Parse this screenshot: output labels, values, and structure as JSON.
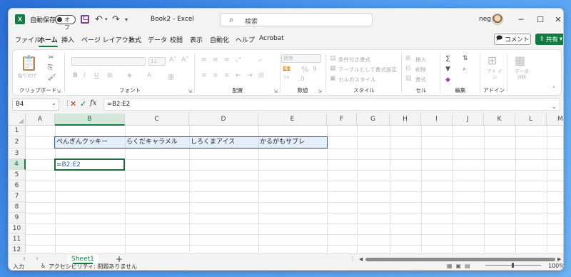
{
  "titlebar": {
    "autosave_label": "自動保存",
    "autosave_state": "オフ",
    "doc_title": "Book2 - Excel",
    "search_placeholder": "検索",
    "user_name": "neg",
    "minimize": "─",
    "maximize": "☐",
    "close": "✕",
    "undo_icon": "↶",
    "redo_icon": "↷",
    "dropdown": "▾",
    "qa_more": "▾"
  },
  "menu": {
    "tabs": [
      "ファイル",
      "ホーム",
      "挿入",
      "ページ レイアウト",
      "数式",
      "データ",
      "校閲",
      "表示",
      "自動化",
      "ヘルプ",
      "Acrobat"
    ],
    "comment_button": "コメント",
    "share_button": "共有"
  },
  "ribbon": {
    "clipboard": {
      "paste": "貼り付け",
      "label": "クリップボード"
    },
    "font": {
      "font_size": "11",
      "label": "フォント",
      "bold": "B",
      "italic": "I",
      "underline": "U"
    },
    "alignment": {
      "label": "配置"
    },
    "number": {
      "format": "標準",
      "percent": "%",
      "label": "数値"
    },
    "styles": {
      "conditional": "条件付き書式",
      "table": "テーブルとして書式設定",
      "cell_styles": "セルのスタイル",
      "label": "スタイル"
    },
    "cells": {
      "insert": "挿入",
      "delete": "削除",
      "format": "書式",
      "label": "セル"
    },
    "editing": {
      "label": "編集"
    },
    "addins": {
      "button": "アド イン",
      "label": "アドイン"
    },
    "data_analysis": {
      "button": "データ 分析"
    }
  },
  "formula_bar": {
    "name_box": "B4",
    "fx": "fx",
    "formula": "=B2:E2"
  },
  "grid": {
    "columns": [
      "A",
      "B",
      "C",
      "D",
      "E",
      "F",
      "G",
      "H",
      "I",
      "J",
      "K",
      "L",
      "M"
    ],
    "rows": [
      "1",
      "2",
      "3",
      "4",
      "5",
      "6",
      "7",
      "8",
      "9",
      "10",
      "11",
      "12"
    ],
    "row2": [
      "ぺんぎんクッキー",
      "らくだキャラメル",
      "しろくまアイス",
      "かるがもサブレ"
    ],
    "active_cell_eq": "=",
    "active_cell_ref": "B2:E2",
    "selected_column": "B",
    "selected_row": "4"
  },
  "sheets": {
    "tabs": [
      "Sheet1"
    ],
    "add": "+"
  },
  "status": {
    "mode": "入力",
    "accessibility": "アクセシビリティ: 問題ありません",
    "zoom": "100%"
  },
  "colors": {
    "accent": "#107c41",
    "range_border": "#2f5fb3"
  }
}
